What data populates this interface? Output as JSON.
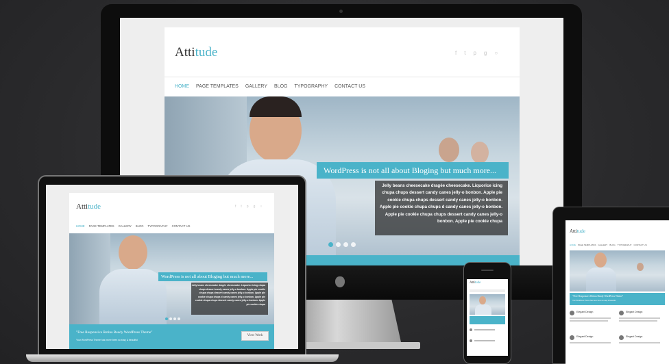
{
  "theme": {
    "accent": "#4ab3c9",
    "frame": "#111111",
    "background": "#2b2b2d"
  },
  "brand": {
    "name_prefix": "Atti",
    "name_suffix": "tude"
  },
  "social_icons": [
    "facebook-icon",
    "twitter-icon",
    "pinterest-icon",
    "gplus-icon",
    "search-icon"
  ],
  "nav": {
    "items": [
      "HOME",
      "PAGE TEMPLATES",
      "GALLERY",
      "BLOG",
      "TYPOGRAPHY",
      "CONTACT US"
    ]
  },
  "slider": {
    "title": "WordPress is not all about Bloging but much more...",
    "text": "Jelly beans cheesecake dragée cheesecake. Liquorice icing chupa chups dessert candy canes jelly-o bonbon. Apple pie cookie chupa chups dessert candy canes jelly-o bonbon. Apple pie cookie chupa chups d candy canes jelly-o bonbon. Apple pie cookie chupa chups dessert candy canes jelly-o bonbon. Apple pie cookie chupa",
    "active_slide": 1,
    "slide_count": 4
  },
  "promo": {
    "headline": "\"Free Responsive Retina Ready WordPress Theme\"",
    "subline": "Your WordPress Theme has never been so easy & beautiful",
    "button": "View Work"
  },
  "features": {
    "item_title": "Elegant Design"
  }
}
